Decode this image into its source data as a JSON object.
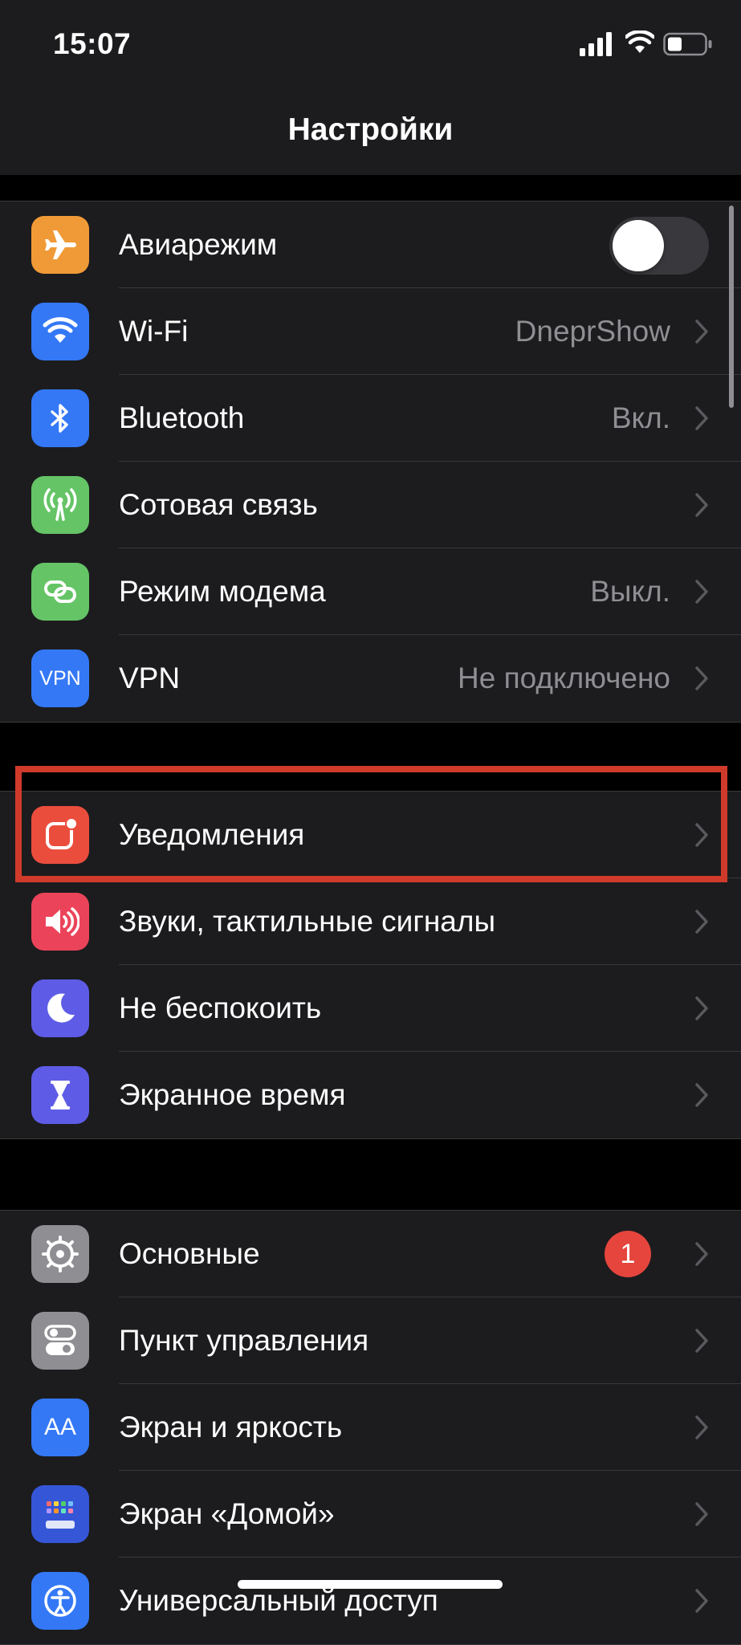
{
  "status": {
    "time": "15:07"
  },
  "nav": {
    "title": "Настройки"
  },
  "colors": {
    "highlight_box": "#d03a2a",
    "background": "#000000",
    "cell": "#1c1c1e"
  },
  "group1": [
    {
      "label": "Авиарежим",
      "icon": "airplane-icon",
      "icon_bg": "#f09a37",
      "control": "toggle",
      "toggle_on": false
    },
    {
      "label": "Wi-Fi",
      "value": "DneprShow",
      "icon": "wifi-icon",
      "icon_bg": "#3478f6"
    },
    {
      "label": "Bluetooth",
      "value": "Вкл.",
      "icon": "bluetooth-icon",
      "icon_bg": "#3478f6"
    },
    {
      "label": "Сотовая связь",
      "value": "",
      "icon": "cellular-antenna-icon",
      "icon_bg": "#65c466"
    },
    {
      "label": "Режим модема",
      "value": "Выкл.",
      "icon": "hotspot-icon",
      "icon_bg": "#65c466"
    },
    {
      "label": "VPN",
      "value": "Не подключено",
      "icon": "vpn-icon",
      "icon_text": "VPN",
      "icon_bg": "#3478f6"
    }
  ],
  "group2": [
    {
      "label": "Уведомления",
      "icon": "notifications-icon",
      "icon_bg": "#eb4d3d"
    },
    {
      "label": "Звуки, тактильные сигналы",
      "icon": "speaker-icon",
      "icon_bg": "#eb445a"
    },
    {
      "label": "Не беспокоить",
      "icon": "moon-icon",
      "icon_bg": "#5e5ce6"
    },
    {
      "label": "Экранное время",
      "icon": "hourglass-icon",
      "icon_bg": "#5e5ce6"
    }
  ],
  "group3": [
    {
      "label": "Основные",
      "badge": "1",
      "icon": "gear-icon",
      "icon_bg": "#8e8e93"
    },
    {
      "label": "Пункт управления",
      "icon": "switches-icon",
      "icon_bg": "#8e8e93"
    },
    {
      "label": "Экран и яркость",
      "icon": "text-size-icon",
      "icon_text": "AA",
      "icon_bg": "#3478f6"
    },
    {
      "label": "Экран «Домой»",
      "icon": "home-grid-icon",
      "icon_bg": "#3556d6"
    },
    {
      "label": "Универсальный доступ",
      "icon": "accessibility-icon",
      "icon_bg": "#3478f6"
    }
  ]
}
